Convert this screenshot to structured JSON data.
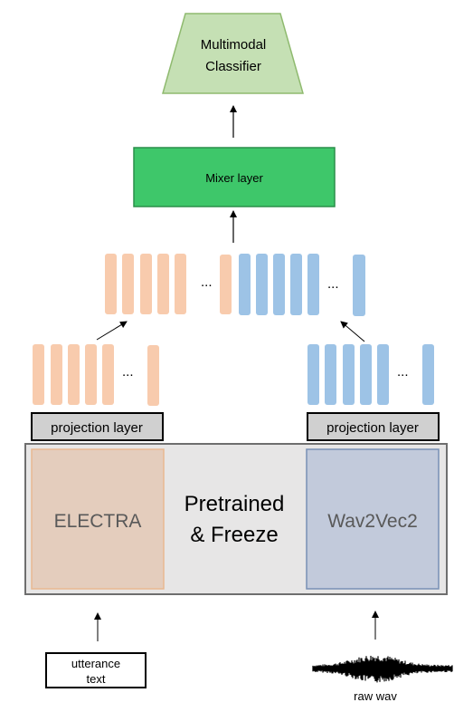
{
  "classifier": {
    "line1": "Multimodal",
    "line2": "Classifier"
  },
  "mixer": {
    "label": "Mixer layer"
  },
  "ellipsis": "...",
  "projection_left": {
    "label": "projection layer"
  },
  "projection_right": {
    "label": "projection layer"
  },
  "frozen_block": {
    "line1": "Pretrained",
    "line2": "& Freeze"
  },
  "text_encoder": {
    "label": "ELECTRA"
  },
  "audio_encoder": {
    "label": "Wav2Vec2"
  },
  "text_input": {
    "line1": "utterance",
    "line2": "text"
  },
  "audio_input": {
    "label": "raw wav"
  },
  "colors": {
    "text_embedding": "#f8cbad",
    "audio_embedding": "#9dc3e6",
    "mixer": "#3ec76a",
    "classifier": "#c5e0b4",
    "projection": "#d0d0d0",
    "frozen_block": "#e7e6e6",
    "electra": "#e4cdbd",
    "wav2vec2": "#c2cadb"
  }
}
